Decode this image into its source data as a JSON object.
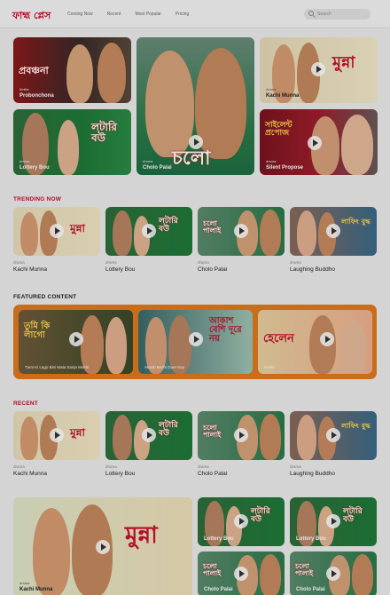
{
  "header": {
    "logo": "ফাহ্ম প্লেস",
    "nav": [
      "Coming Now",
      "Recent",
      "Most Popular",
      "Pricing"
    ],
    "search_placeholder": "Search"
  },
  "hero": [
    {
      "category": "thriller",
      "title": "Probonchona",
      "art": "প্রবঞ্চনা"
    },
    {
      "category": "drama",
      "title": "Lottery Bou",
      "art": "লটারি বউ"
    },
    {
      "category": "drama",
      "title": "Cholo Palai",
      "art": "চলো"
    },
    {
      "category": "drama",
      "title": "Kachi Munna",
      "art": "মুন্না"
    },
    {
      "category": "drama",
      "title": "Silent Propose",
      "art": "সাইলেন্ট প্রপোজ"
    }
  ],
  "trending": {
    "title": "TRENDING NOW",
    "items": [
      {
        "category": "drama",
        "title": "Kachi Munna",
        "art": "মুন্না"
      },
      {
        "category": "drama",
        "title": "Lottery Bou",
        "art": "লটারি বউ"
      },
      {
        "category": "drama",
        "title": "Cholo Palai",
        "art": "চলো পালাই"
      },
      {
        "category": "drama",
        "title": "Laughing Buddho",
        "art": "লাফিং বুদ্ধ"
      }
    ]
  },
  "featured": {
    "title": "FEATURED CONTENT",
    "items": [
      {
        "title": "Tumi Ki Lago Bini Mala Sanja Mukhi",
        "art": "তুমি কি লাগো"
      },
      {
        "title": "Akash Beshi Dure Noy",
        "art": "আকাশ বেশি দূরে নয়"
      },
      {
        "title": "Helen",
        "art": "হেলেন"
      }
    ]
  },
  "recent": {
    "title": "RECENT",
    "items": [
      {
        "category": "drama",
        "title": "Kachi Munna",
        "art": "মুন্না"
      },
      {
        "category": "drama",
        "title": "Lottery Bou",
        "art": "লটারি বউ"
      },
      {
        "category": "drama",
        "title": "Cholo Palai",
        "art": "চলো পালাই"
      },
      {
        "category": "drama",
        "title": "Laughing Buddho",
        "art": "লাফিং বুদ্ধ"
      }
    ]
  },
  "bottom": {
    "big": {
      "category": "drama",
      "title": "Kachi Munna",
      "art": "মুন্না"
    },
    "small": [
      {
        "title": "Lottery Bou",
        "art": "লটারি বউ"
      },
      {
        "title": "Lottery Bou",
        "art": "লটারি বউ"
      },
      {
        "title": "Cholo Palai",
        "art": "চলো পালাই"
      },
      {
        "title": "Cholo Palai",
        "art": "চলো পালাই"
      }
    ]
  },
  "colors": {
    "accent": "#c8102e",
    "featured_bg": "#e07a1f",
    "green": "#1f7a3a"
  }
}
